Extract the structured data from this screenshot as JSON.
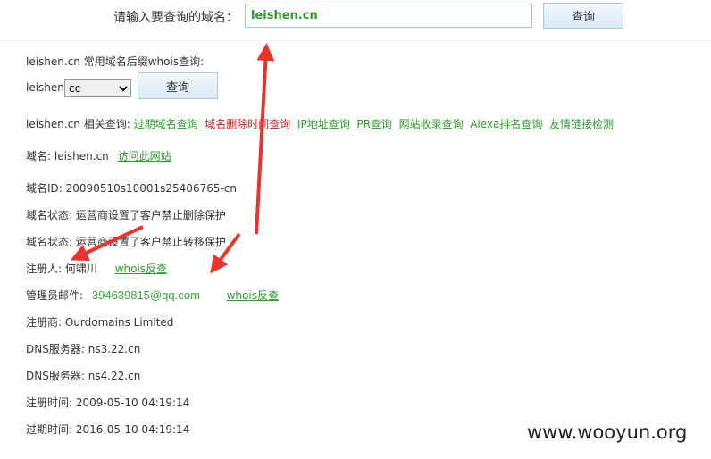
{
  "search": {
    "label": "请输入要查询的域名：",
    "value": "leishen.cn",
    "button": "查询"
  },
  "suffix": {
    "title": "leishen.cn 常用域名后缀whois查询:",
    "prefix": "leishen.",
    "selected": "cc",
    "button": "查询"
  },
  "related": {
    "label": "leishen.cn 相关查询:",
    "links": [
      "过期域名查询",
      "域名删除时间查询",
      "IP地址查询",
      "PR查询",
      "网站收录查询",
      "Alexa排名查询",
      "友情链接检测"
    ]
  },
  "whois": {
    "domain_label": "域名:",
    "domain_value": "leishen.cn",
    "visit_link": "访问此网站",
    "id_label": "域名ID:",
    "id_value": "20090510s10001s25406765-cn",
    "status1_label": "域名状态:",
    "status1_value": "运营商设置了客户禁止删除保护",
    "status2_label": "域名状态:",
    "status2_value": "运营商设置了客户禁止转移保护",
    "registrant_label": "注册人:",
    "registrant_value": "何啸川",
    "registrant_reverse": "whois反查",
    "admin_email_label": "管理员邮件:",
    "admin_email_value": "394639815@qq.com",
    "admin_email_reverse": "whois反查",
    "registrar_label": "注册商:",
    "registrar_value": "Ourdomains Limited",
    "dns1_label": "DNS服务器:",
    "dns1_value": "ns3.22.cn",
    "dns2_label": "DNS服务器:",
    "dns2_value": "ns4.22.cn",
    "created_label": "注册时间:",
    "created_value": "2009-05-10 04:19:14",
    "expires_label": "过期时间:",
    "expires_value": "2016-05-10 04:19:14"
  },
  "watermark": "www.wooyun.org",
  "colors": {
    "link_green": "#2a9a2a",
    "link_red": "#cc1f1f",
    "arrow_red": "#e8332f"
  }
}
